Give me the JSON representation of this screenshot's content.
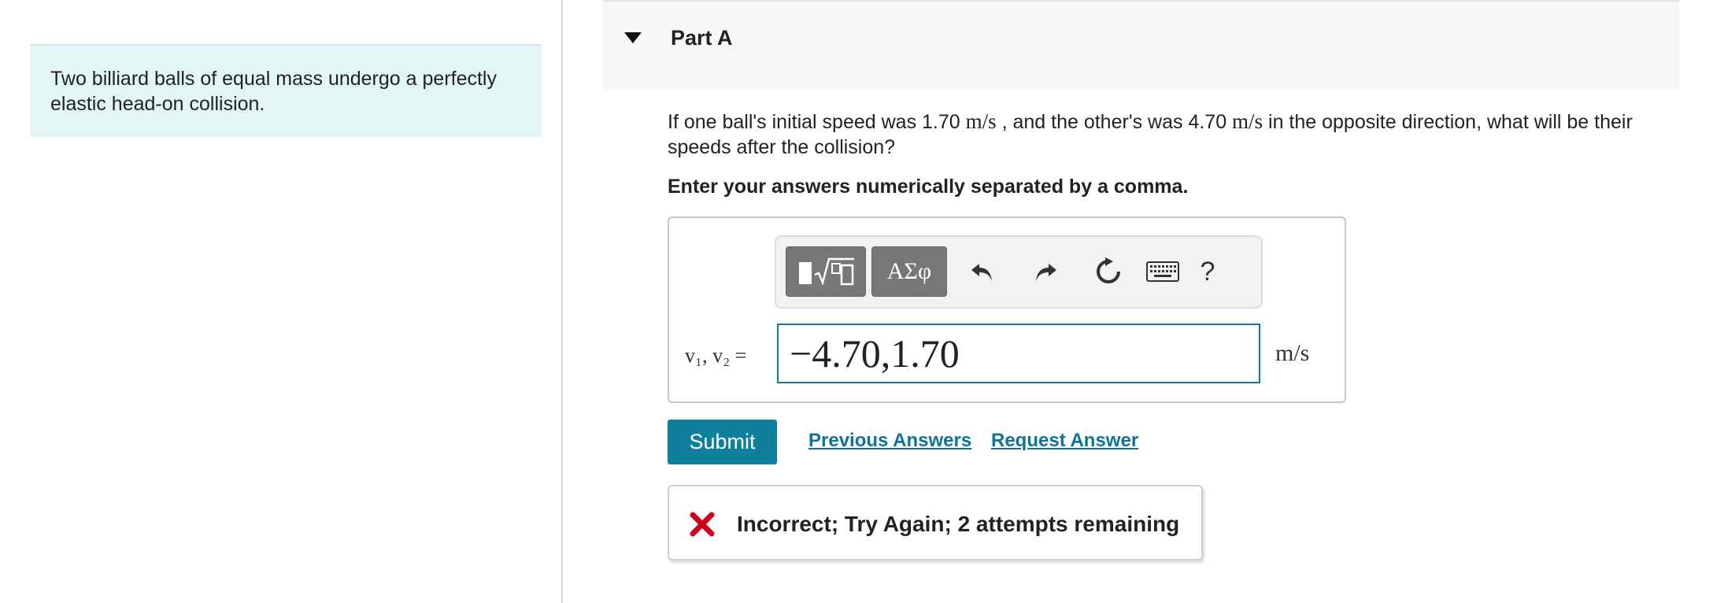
{
  "intro": {
    "text": "Two billiard balls of equal mass undergo a perfectly elastic head-on collision."
  },
  "part": {
    "title": "Part A"
  },
  "question": {
    "text_1": "If one ball's initial speed was 1.70 ",
    "unit_1": "m/s",
    "text_2": " , and the other's was 4.70 ",
    "unit_2": "m/s",
    "text_3": " in the opposite direction, what will be their speeds after the collision?"
  },
  "instruction": "Enter your answers numerically separated by a comma.",
  "toolbar": {
    "symbols_label": "ΑΣφ",
    "help_label": "?"
  },
  "answer": {
    "variable_label": "v₁, v₂ =",
    "value": "−4.70,1.70",
    "unit": "m/s"
  },
  "actions": {
    "submit_label": "Submit",
    "previous_answers_label": "Previous Answers",
    "request_answer_label": "Request Answer"
  },
  "feedback": {
    "message": "Incorrect; Try Again; 2 attempts remaining",
    "status_color": "#d0021b"
  },
  "colors": {
    "accent": "#0f7f9e",
    "intro_bg": "#e4f5f5"
  }
}
